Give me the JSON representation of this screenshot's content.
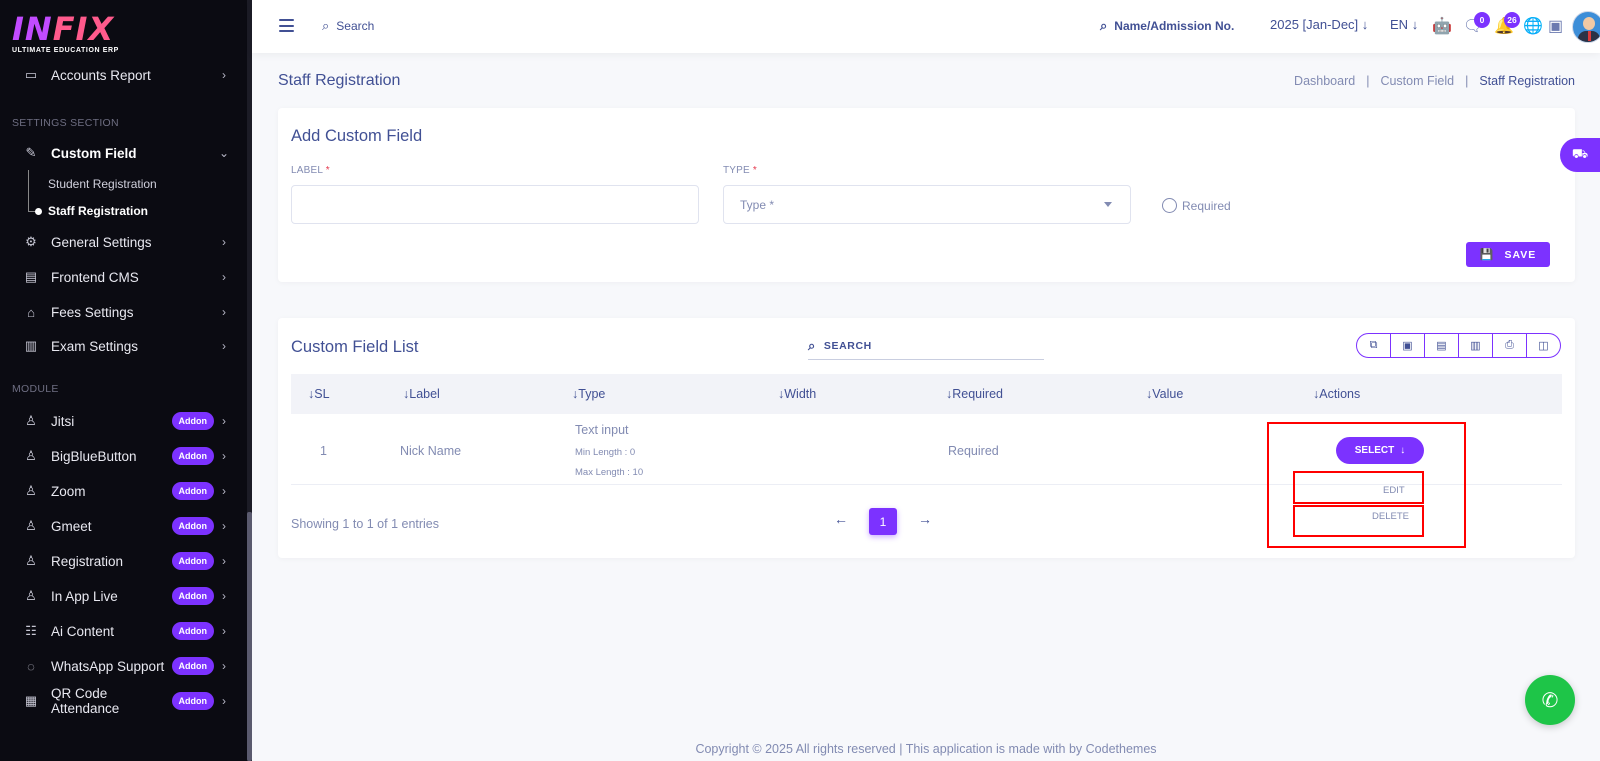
{
  "brand": {
    "logo_a": "IN",
    "logo_b": "FIX",
    "subtitle": "ULTIMATE EDUCATION ERP"
  },
  "sidebar": {
    "accounts_report": "Accounts Report",
    "settings_title": "SETTINGS SECTION",
    "custom_field": "Custom Field",
    "sub_student": "Student Registration",
    "sub_staff": "Staff Registration",
    "general_settings": "General Settings",
    "frontend_cms": "Frontend CMS",
    "fees_settings": "Fees Settings",
    "exam_settings": "Exam Settings",
    "module_title": "MODULE",
    "addon_label": "Addon",
    "modules": [
      "Jitsi",
      "BigBlueButton",
      "Zoom",
      "Gmeet",
      "Registration",
      "In App Live",
      "Ai Content",
      "WhatsApp Support",
      "QR Code Attendance"
    ]
  },
  "topbar": {
    "search_label": "Search",
    "admission_label": "Name/Admission No.",
    "year": "2025 [Jan-Dec]",
    "lang": "EN",
    "chat_count": "0",
    "notif_count": "26"
  },
  "header": {
    "title": "Staff Registration",
    "breadcrumb": [
      "Dashboard",
      "Custom Field",
      "Staff Registration"
    ],
    "separator": "|"
  },
  "form": {
    "title": "Add Custom Field",
    "label_field": "LABEL",
    "type_field": "TYPE",
    "required_star": "*",
    "type_placeholder": "Type *",
    "required_label": "Required",
    "save_label": "SAVE"
  },
  "list": {
    "title": "Custom Field List",
    "search_label": "SEARCH",
    "columns": [
      "SL",
      "Label",
      "Type",
      "Width",
      "Required",
      "Value",
      "Actions"
    ],
    "rows": [
      {
        "sl": "1",
        "label": "Nick Name",
        "type": "Text input",
        "min": "Min Length : 0",
        "max": "Max Length : 10",
        "required": "Required"
      }
    ],
    "select_label": "SELECT",
    "edit_label": "EDIT",
    "delete_label": "DELETE",
    "showing": "Showing 1 to 1 of 1 entries",
    "current_page": "1"
  },
  "footer": {
    "copyright": "Copyright © 2025 All rights reserved | This application is made with by Codethemes"
  },
  "colors": {
    "accent": "#7c32ff",
    "sidebar_bg": "#0b0b12",
    "text_primary": "#415094",
    "text_muted": "#828bb2",
    "highlight": "#ff0000",
    "whatsapp": "#1ec548"
  }
}
